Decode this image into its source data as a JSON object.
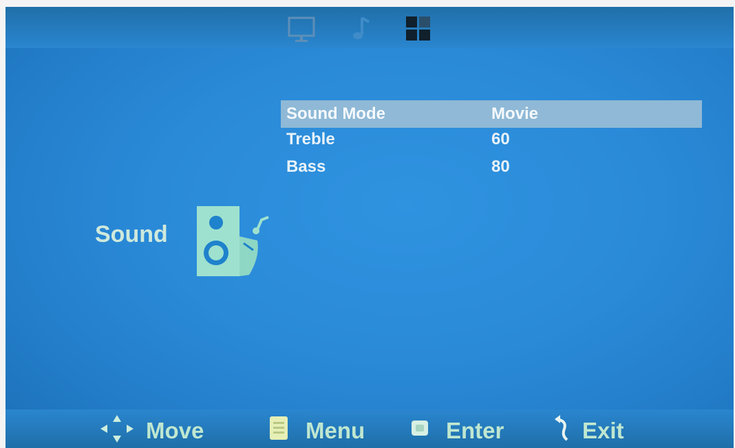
{
  "tabs": [
    {
      "icon": "monitor-icon",
      "name": "picture"
    },
    {
      "icon": "music-note-icon",
      "name": "sound"
    },
    {
      "icon": "grid-icon",
      "name": "setup"
    }
  ],
  "category": {
    "label": "Sound",
    "icon": "speaker-music-icon"
  },
  "menu": {
    "rows": [
      {
        "label": "Sound Mode",
        "value": "Movie",
        "selected": true
      },
      {
        "label": "Treble",
        "value": "60",
        "selected": false
      },
      {
        "label": "Bass",
        "value": "80",
        "selected": false
      }
    ]
  },
  "hints": {
    "move": "Move",
    "menu": "Menu",
    "enter": "Enter",
    "exit": "Exit"
  },
  "colors": {
    "background": "#2a8ad8",
    "selection": "#8fb9d6",
    "accent_text": "#bfe7d0"
  }
}
